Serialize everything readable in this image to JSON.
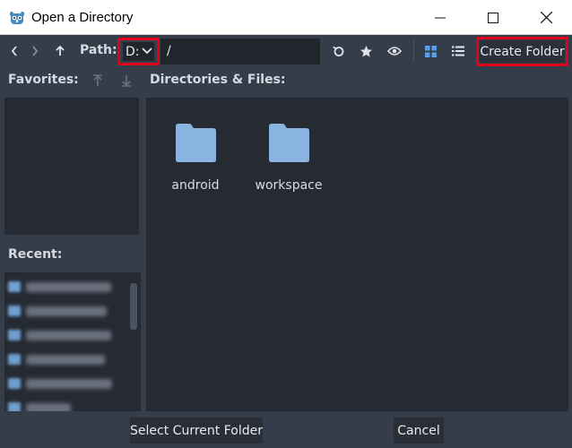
{
  "window": {
    "title": "Open a Directory",
    "app_icon": "godot-icon"
  },
  "toolbar": {
    "back_icon": "chevron-left-icon",
    "forward_icon": "chevron-right-icon",
    "up_icon": "arrow-up-icon",
    "path_label": "Path:",
    "drive_value": "D:",
    "path_value": "/",
    "refresh_icon": "refresh-icon",
    "favorite_icon": "star-icon",
    "hidden_toggle_icon": "eye-icon",
    "grid_view_icon": "grid-icon",
    "list_view_icon": "list-icon",
    "create_folder_label": "Create Folder"
  },
  "sidebar": {
    "favorites_label": "Favorites:",
    "recent_label": "Recent:"
  },
  "files": {
    "label": "Directories & Files:",
    "items": [
      {
        "name": "android",
        "icon": "folder-icon"
      },
      {
        "name": "workspace",
        "icon": "folder-icon"
      }
    ]
  },
  "footer": {
    "select_label": "Select Current Folder",
    "cancel_label": "Cancel"
  },
  "colors": {
    "background": "#363d4a",
    "panel": "#262b33",
    "highlight_box": "#e3001b",
    "folder": "#8ab4e0",
    "accent": "#5d9ee8"
  }
}
